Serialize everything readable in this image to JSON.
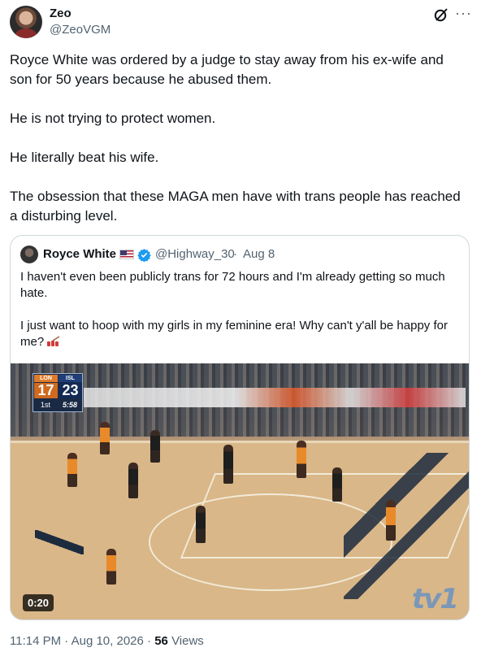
{
  "post": {
    "author_name": "Zeo",
    "author_handle": "@ZeoVGM",
    "paragraphs": [
      "Royce White was ordered by a judge to stay away from his ex-wife and son for 50 years because he abused them.",
      "He is not trying to protect women.",
      "He literally beat his wife.",
      "The obsession that these MAGA men have with trans people has reached a disturbing level."
    ],
    "time": "11:14 PM",
    "separator": "·",
    "date": "Aug 10, 2026",
    "views_count": "56",
    "views_label": "Views"
  },
  "quoted": {
    "author_name": "Royce White",
    "author_handle": "@Highway_30",
    "separator": "·",
    "date": "Aug 8",
    "paragraphs": [
      "I haven't even been publicly trans for 72 hours and I'm already getting so much hate.",
      "I just want to hoop with my girls in my feminine era! Why can't y'all be happy for me?"
    ],
    "video": {
      "duration": "0:20",
      "scoreboard": {
        "home_team": "LON",
        "away_team": "ISL",
        "home_score": "17",
        "away_score": "23",
        "period": "1st",
        "clock": "5:58"
      },
      "channel_logo": "tv1"
    }
  },
  "icons": {
    "grok": "grok-icon",
    "more": "more-icon",
    "verified": "verified-badge-icon",
    "flag": "us-flag-icon",
    "emoji": "nail-polish-emoji"
  },
  "colors": {
    "text": "#0f1419",
    "secondary": "#536471",
    "verified": "#1d9bf0",
    "border": "#cfd9de"
  }
}
